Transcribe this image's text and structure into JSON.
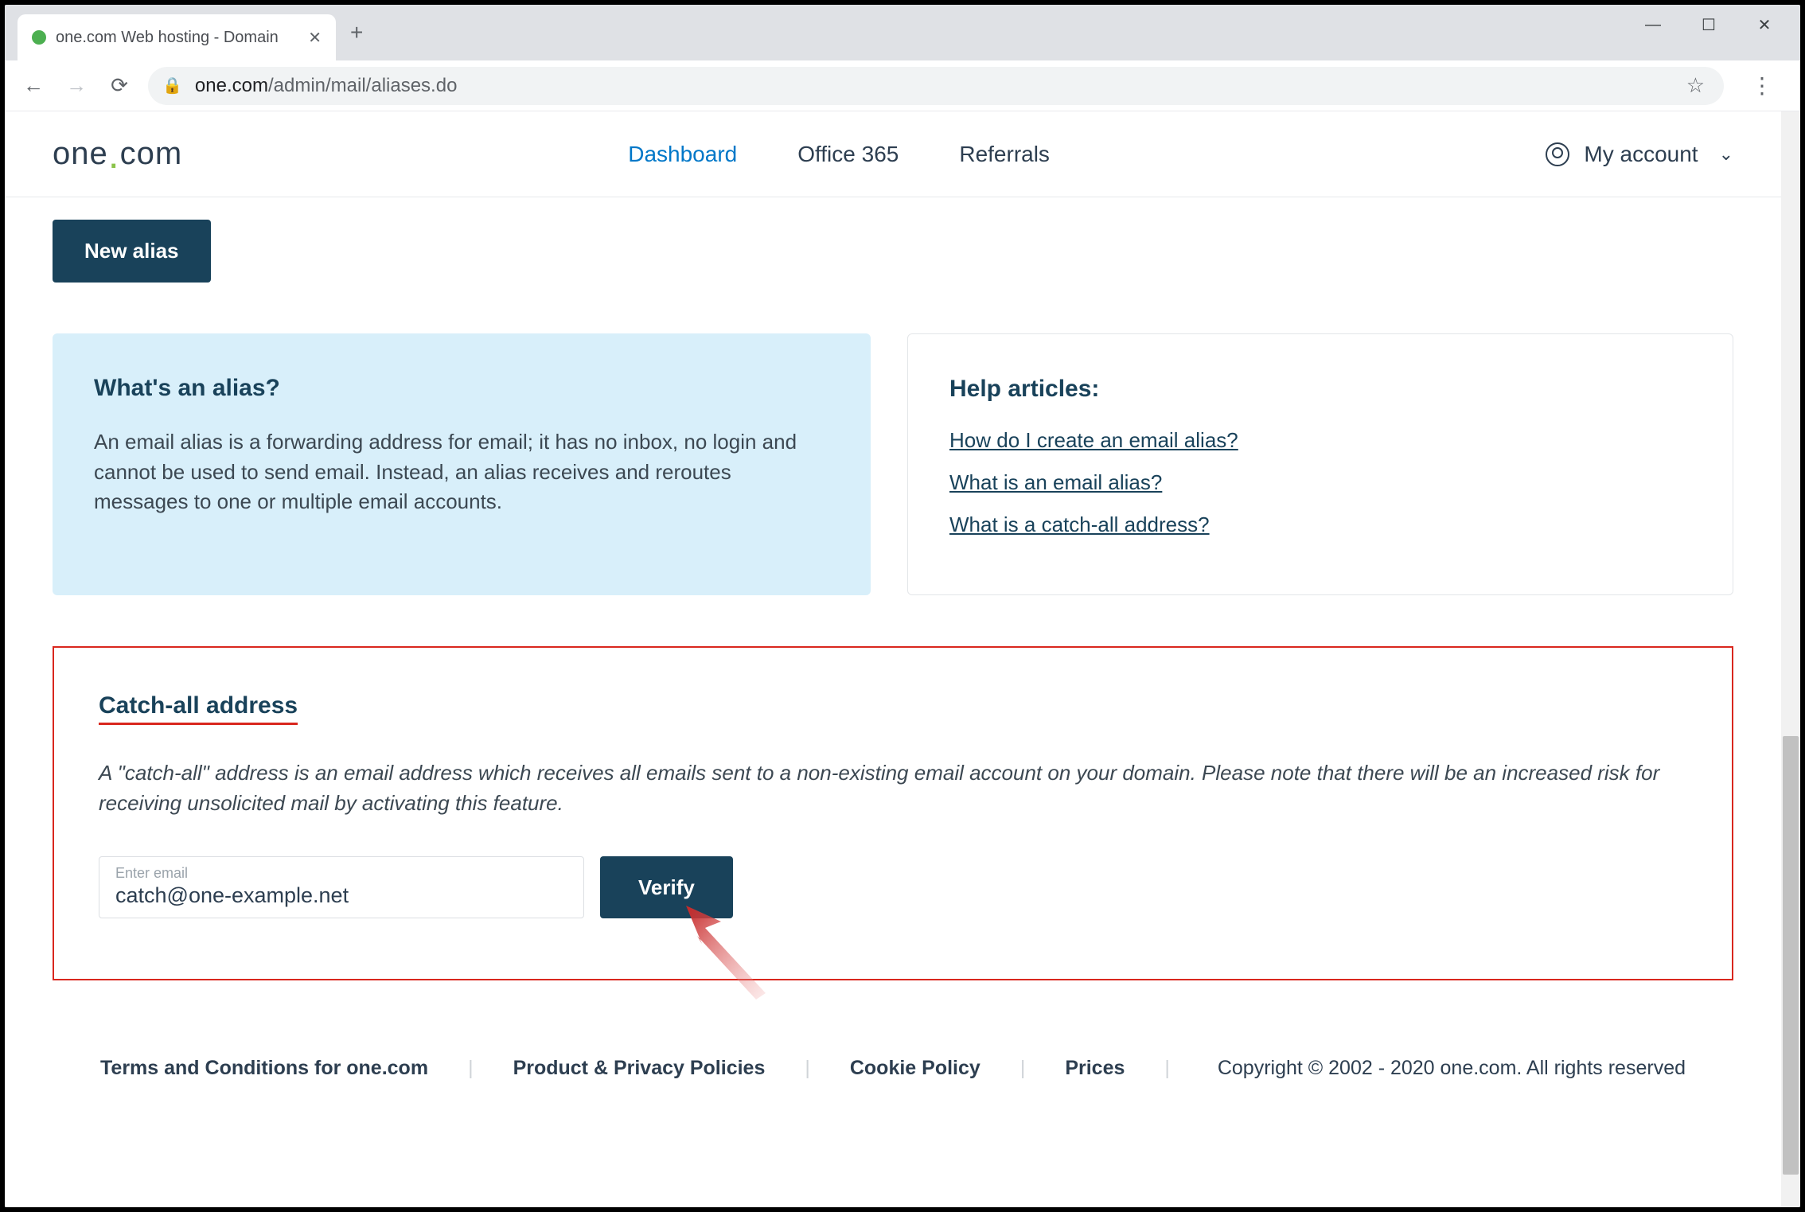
{
  "browser": {
    "tab_title": "one.com Web hosting  -  Domain",
    "url_host": "one.com",
    "url_path": "/admin/mail/aliases.do"
  },
  "header": {
    "logo_left": "one",
    "logo_right": "com",
    "nav": {
      "dashboard": "Dashboard",
      "office365": "Office 365",
      "referrals": "Referrals"
    },
    "account_label": "My account"
  },
  "new_alias_label": "New alias",
  "alias_panel": {
    "title": "What's an alias?",
    "body": "An email alias is a forwarding address for email; it has no inbox, no login and cannot be used to send email. Instead, an alias receives and reroutes messages to one or multiple email accounts."
  },
  "help_panel": {
    "title": "Help articles:",
    "links": [
      "How do I create an email alias?",
      "What is an email alias?",
      "What is a catch-all address?"
    ]
  },
  "catchall": {
    "title": "Catch-all address",
    "body": "A \"catch-all\" address is an email address which receives all emails sent to a non-existing email account on your domain. Please note that there will be an increased risk for receiving unsolicited mail by activating this feature.",
    "input_label": "Enter email",
    "input_value": "catch@one-example.net",
    "verify_label": "Verify"
  },
  "footer": {
    "terms": "Terms and Conditions for one.com",
    "policies": "Product & Privacy Policies",
    "cookie": "Cookie Policy",
    "prices": "Prices",
    "copyright": "Copyright © 2002 - 2020 one.com. All rights reserved"
  }
}
